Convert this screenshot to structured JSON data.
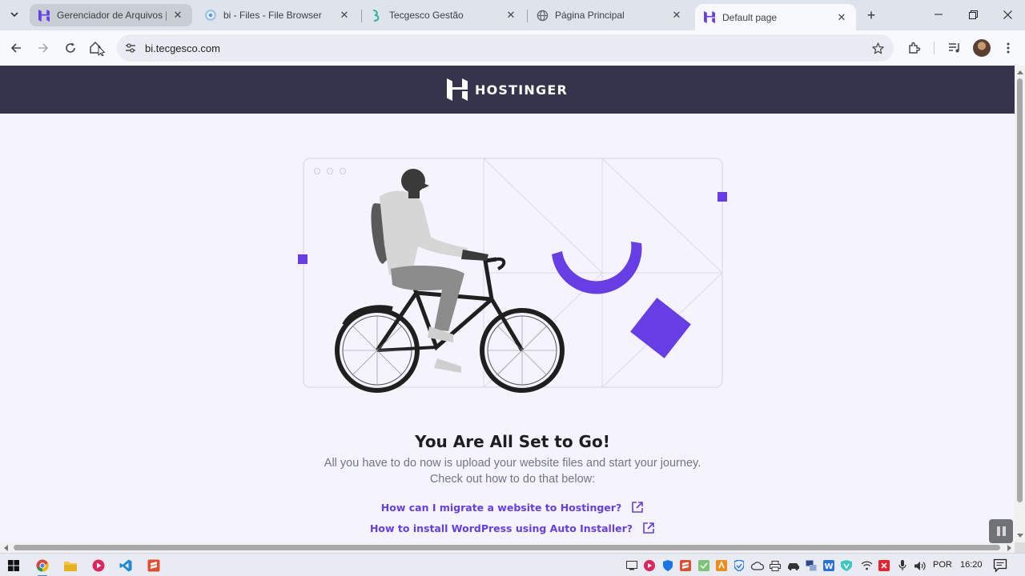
{
  "browser": {
    "tabs": [
      {
        "title": "Gerenciador de Arquivos | H",
        "favicon": "hostinger-icon",
        "state": "hovered"
      },
      {
        "title": "bi - Files - File Browser",
        "favicon": "filebrowser-icon",
        "state": "normal"
      },
      {
        "title": "Tecgesco Gestão",
        "favicon": "tecgesco-icon",
        "state": "normal"
      },
      {
        "title": "Página Principal",
        "favicon": "globe-icon",
        "state": "normal"
      },
      {
        "title": "Default page",
        "favicon": "hostinger-icon",
        "state": "active"
      }
    ],
    "url": "bi.tecgesco.com"
  },
  "page": {
    "brand": "HOSTINGER",
    "headline": "You Are All Set to Go!",
    "subtext_line1": "All you have to do now is upload your website files and start your journey.",
    "subtext_line2": "Check out how to do that below:",
    "links": [
      {
        "label": "How can I migrate a website to Hostinger?"
      },
      {
        "label": "How to install WordPress using Auto Installer?"
      }
    ]
  },
  "taskbar": {
    "language": "POR",
    "time": "16:20"
  },
  "colors": {
    "header_bg": "#36344d",
    "page_bg": "#f4f3fe",
    "accent_purple": "#673de6",
    "headline": "#1d1e20",
    "subtext": "#727586"
  }
}
